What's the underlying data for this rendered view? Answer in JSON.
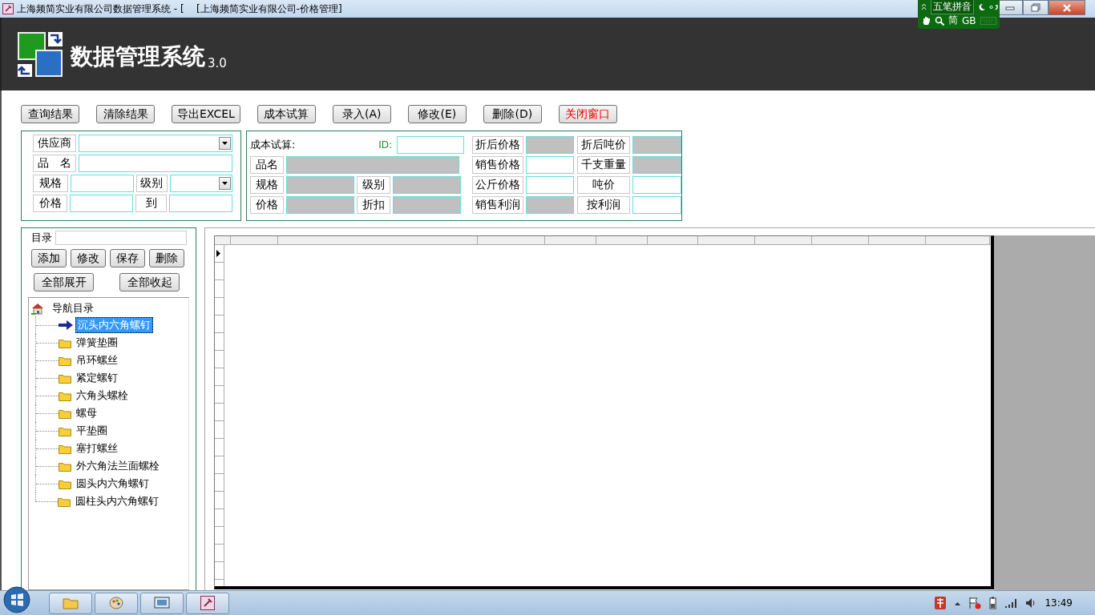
{
  "window": {
    "title": "上海频简实业有限公司数据管理系统 - [    [上海频简实业有限公司-价格管理]"
  },
  "ime": {
    "mode": "五笔拼音",
    "script": "简",
    "charset": "GB"
  },
  "header": {
    "title": "数据管理系统",
    "version": "3.0"
  },
  "toolbar": [
    {
      "label": "查询结果",
      "kind": "plain"
    },
    {
      "label": "清除结果",
      "kind": "plain"
    },
    {
      "label": "导出EXCEL",
      "kind": "plain"
    },
    {
      "label": "成本试算",
      "kind": "plain"
    },
    {
      "label": "录入(A)",
      "kind": "plain"
    },
    {
      "label": "修改(E)",
      "kind": "plain"
    },
    {
      "label": "删除(D)",
      "kind": "plain"
    },
    {
      "label": "关闭窗口",
      "kind": "close"
    }
  ],
  "query": {
    "rows": [
      [
        {
          "label": "供应商",
          "kind": "combo"
        }
      ],
      [
        {
          "label": "品　名",
          "kind": "text"
        }
      ],
      [
        {
          "label": "规格",
          "kind": "text"
        },
        {
          "label": "级别",
          "kind": "combo"
        }
      ],
      [
        {
          "label": "价格",
          "kind": "text"
        },
        {
          "label": "到",
          "kind": "text"
        }
      ]
    ]
  },
  "cost": {
    "title": "成本试算:",
    "id_label": "ID:",
    "rows": [
      [
        {
          "label": "品名",
          "readonly": true
        }
      ],
      [
        {
          "label": "规格",
          "readonly": true
        },
        {
          "label": "级别",
          "readonly": true
        }
      ],
      [
        {
          "label": "价格",
          "readonly": true
        },
        {
          "label": "折扣",
          "readonly": true
        }
      ]
    ],
    "results": [
      [
        {
          "label": "折后价格",
          "readonly": true
        },
        {
          "label": "折后吨价",
          "readonly": true
        }
      ],
      [
        {
          "label": "销售价格",
          "readonly": false
        },
        {
          "label": "千支重量",
          "readonly": true
        }
      ],
      [
        {
          "label": "公斤价格",
          "readonly": false
        },
        {
          "label": "吨价",
          "readonly": false
        }
      ],
      [
        {
          "label": "销售利润",
          "readonly": true
        },
        {
          "label": "按利润",
          "readonly": false
        }
      ]
    ]
  },
  "catalog": {
    "label": "目录",
    "buttons": [
      "添加",
      "修改",
      "保存",
      "删除"
    ],
    "expand_buttons": [
      "全部展开",
      "全部收起"
    ],
    "tree": {
      "label": "导航目录",
      "children": [
        {
          "label": "沉头内六角螺钉",
          "selected": true
        },
        {
          "label": "弹簧垫圈",
          "selected": false
        },
        {
          "label": "吊环螺丝",
          "selected": false
        },
        {
          "label": "紧定螺钉",
          "selected": false
        },
        {
          "label": "六角头螺栓",
          "selected": false
        },
        {
          "label": "螺母",
          "selected": false
        },
        {
          "label": "平垫圈",
          "selected": false
        },
        {
          "label": "塞打螺丝",
          "selected": false
        },
        {
          "label": "外六角法兰面螺栓",
          "selected": false
        },
        {
          "label": "圆头内六角螺钉",
          "selected": false
        },
        {
          "label": "圆柱头内六角螺钉",
          "selected": false
        }
      ]
    }
  },
  "taskbar": {
    "clock": "13:49"
  }
}
